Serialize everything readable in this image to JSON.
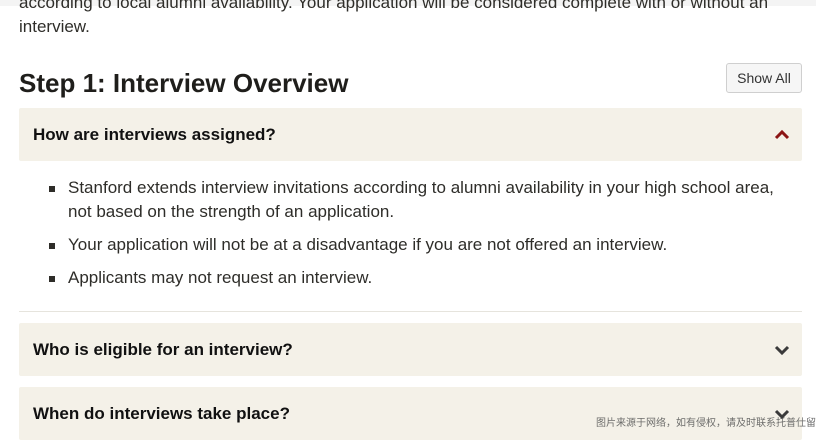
{
  "intro": {
    "text": "according to local alumni availability. Your application will be considered complete with or without an interview."
  },
  "step": {
    "title": "Step 1: Interview Overview",
    "show_all": "Show All"
  },
  "accordion": [
    {
      "question": "How are interviews assigned?",
      "state": "expanded",
      "icon": "chevron-up-icon",
      "answers": [
        "Stanford extends interview invitations according to alumni availability in your high school area, not based on the strength of an application.",
        "Your application will not be at a disadvantage if you are not offered an interview.",
        "Applicants may not request an interview."
      ]
    },
    {
      "question": "Who is eligible for an interview?",
      "state": "collapsed",
      "icon": "chevron-down-icon"
    },
    {
      "question": "When do interviews take place?",
      "state": "collapsed",
      "icon": "chevron-down-icon"
    }
  ],
  "watermark": {
    "text": "图片来源于网络，如有侵权，请及时联系托普仕留学删除"
  },
  "colors": {
    "accent": "#8c1515",
    "accordion_bg": "#f4f1e8",
    "text": "#2e2d29"
  }
}
